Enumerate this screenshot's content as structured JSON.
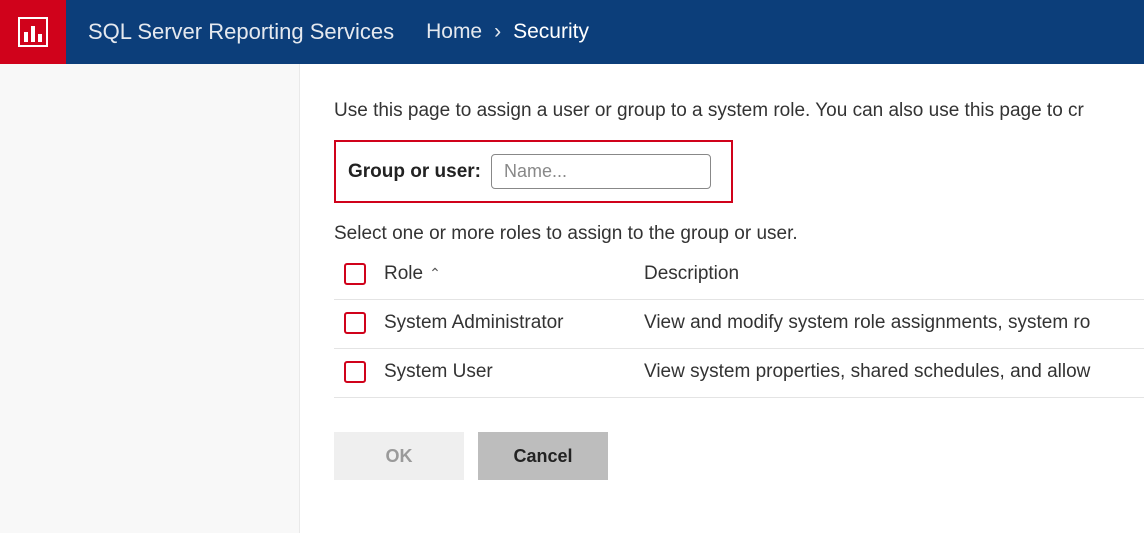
{
  "header": {
    "app_title": "SQL Server Reporting Services",
    "breadcrumb": {
      "home": "Home",
      "current": "Security"
    }
  },
  "main": {
    "intro": "Use this page to assign a user or group to a system role. You can also use this page to cr",
    "group_label": "Group or user:",
    "name_placeholder": "Name...",
    "select_text": "Select one or more roles to assign to the group or user.",
    "columns": {
      "role": "Role",
      "description": "Description"
    },
    "roles": [
      {
        "name": "System Administrator",
        "description": "View and modify system role assignments, system ro"
      },
      {
        "name": "System User",
        "description": "View system properties, shared schedules, and allow"
      }
    ],
    "buttons": {
      "ok": "OK",
      "cancel": "Cancel"
    }
  },
  "colors": {
    "brand_red": "#d0021b",
    "brand_blue": "#0c3e7a"
  }
}
